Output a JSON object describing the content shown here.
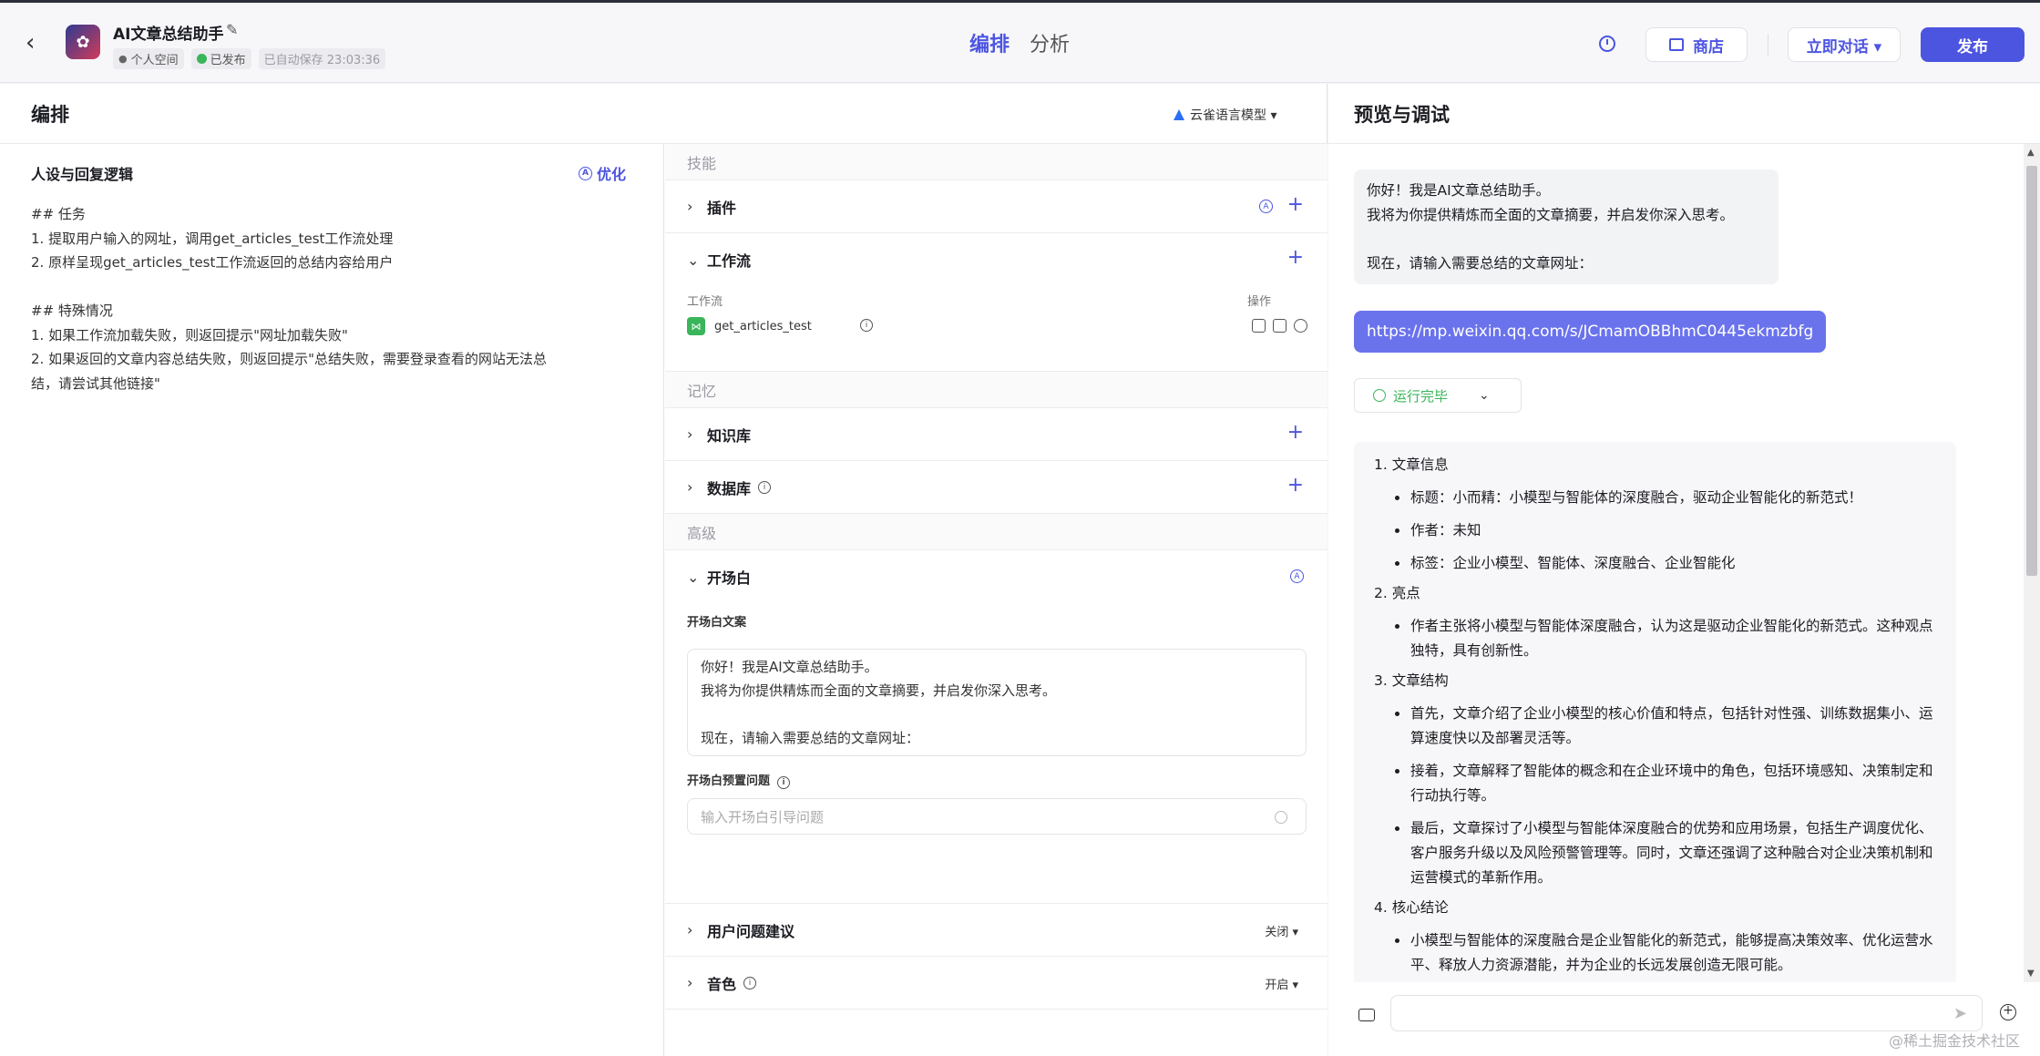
{
  "header": {
    "app_title": "AI文章总结助手",
    "space_label": "个人空间",
    "published_label": "已发布",
    "autosave_label": "已自动保存 23:03:36",
    "tab_arrange": "编排",
    "tab_analyze": "分析",
    "store_label": "商店",
    "chat_now_label": "立即对话 ▾",
    "publish_label": "发布"
  },
  "left": {
    "title": "编排",
    "model_label": "云雀语言模型 ▾",
    "persona": {
      "title": "人设与回复逻辑",
      "optimize_label": "优化",
      "text": "## 任务\n1. 提取用户输入的网址，调用get_articles_test工作流处理\n2. 原样呈现get_articles_test工作流返回的总结内容给用户\n\n## 特殊情况\n1. 如果工作流加载失败，则返回提示\"网址加载失败\"\n2. 如果返回的文章内容总结失败，则返回提示\"总结失败，需要登录查看的网站无法总\n结，请尝试其他链接\""
    },
    "skills": {
      "group_skill": "技能",
      "plugin": "插件",
      "workflow": "工作流",
      "workflow_col_label": "工作流",
      "workflow_op_label": "操作",
      "workflow_item": "get_articles_test",
      "group_memory": "记忆",
      "knowledge": "知识库",
      "database": "数据库",
      "group_advanced": "高级",
      "opening": "开场白",
      "opening_text_label": "开场白文案",
      "opening_text": "你好！我是AI文章总结助手。\n我将为你提供精炼而全面的文章摘要，并启发你深入思考。\n\n现在，请输入需要总结的文章网址：",
      "preset_label": "开场白预置问题",
      "preset_placeholder": "输入开场白引导问题",
      "suggest": "用户问题建议",
      "suggest_value": "关闭 ▾",
      "voice": "音色",
      "voice_value": "开启 ▾"
    }
  },
  "right": {
    "title": "预览与调试",
    "welcome": "你好！我是AI文章总结助手。\n我将为你提供精炼而全面的文章摘要，并启发你深入思考。\n\n现在，请输入需要总结的文章网址：",
    "user_msg": "https://mp.weixin.qq.com/s/JCmamOBBhmC0445ekmzbfg",
    "run_status": "运行完毕",
    "answer": {
      "s1": "1. 文章信息",
      "s1_items": [
        "标题：小而精：小模型与智能体的深度融合，驱动企业智能化的新范式！",
        "作者：未知",
        "标签：企业小模型、智能体、深度融合、企业智能化"
      ],
      "s2": "2. 亮点",
      "s2_items": [
        "作者主张将小模型与智能体深度融合，认为这是驱动企业智能化的新范式。这种观点独特，具有创新性。"
      ],
      "s3": "3. 文章结构",
      "s3_items": [
        "首先，文章介绍了企业小模型的核心价值和特点，包括针对性强、训练数据集小、运算速度快以及部署灵活等。",
        "接着，文章解释了智能体的概念和在企业环境中的角色，包括环境感知、决策制定和行动执行等。",
        "最后，文章探讨了小模型与智能体深度融合的优势和应用场景，包括生产调度优化、客户服务升级以及风险预警管理等。同时，文章还强调了这种融合对企业决策机制和运营模式的革新作用。"
      ],
      "s4": "4. 核心结论",
      "s4_items": [
        "小模型与智能体的深度融合是企业智能化的新范式，能够提高决策效率、优化运营水平、释放人力资源潜能，并为企业的长远发展创造无限可能。"
      ]
    },
    "watermark": "@稀土掘金技术社区"
  }
}
